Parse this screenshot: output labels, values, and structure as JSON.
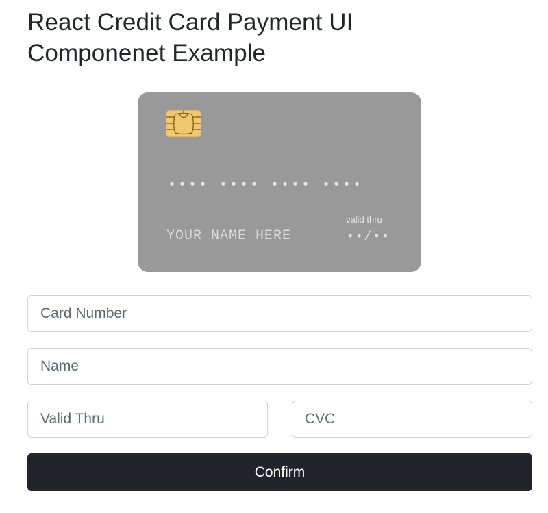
{
  "page": {
    "title_line1": "React Credit Card Payment UI",
    "title_line2": "Componenet Example"
  },
  "card": {
    "number_placeholder": "•••• •••• •••• ••••",
    "name_placeholder": "YOUR NAME HERE",
    "valid_label": "valid thru",
    "expiry_placeholder": "••/••",
    "background_color": "#999999",
    "chip_color": "#f2c76e"
  },
  "form": {
    "card_number": {
      "value": "",
      "placeholder": "Card Number"
    },
    "name": {
      "value": "",
      "placeholder": "Name"
    },
    "valid_thru": {
      "value": "",
      "placeholder": "Valid Thru"
    },
    "cvc": {
      "value": "",
      "placeholder": "CVC"
    },
    "confirm_label": "Confirm"
  },
  "colors": {
    "button_background": "#212529",
    "input_border": "#ced4da"
  }
}
